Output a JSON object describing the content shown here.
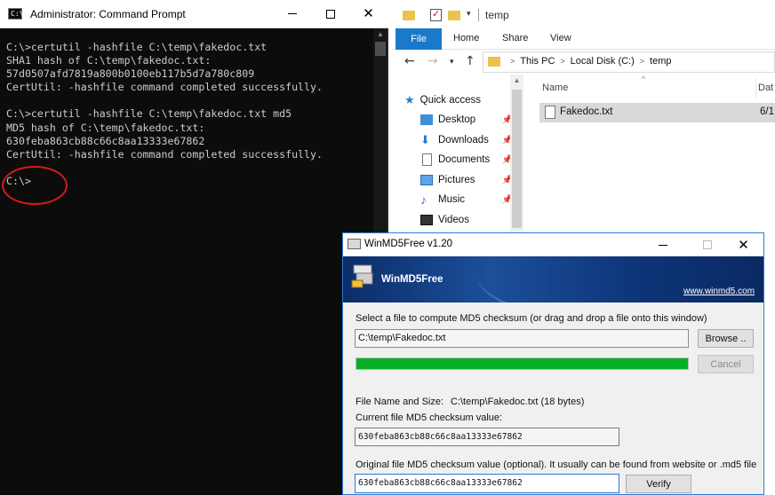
{
  "cmd": {
    "title": "Administrator: Command Prompt",
    "icon_text": "C:\\",
    "output": "C:\\>certutil -hashfile C:\\temp\\fakedoc.txt\nSHA1 hash of C:\\temp\\fakedoc.txt:\n57d0507afd7819a800b0100eb117b5d7a780c809\nCertUtil: -hashfile command completed successfully.\n\nC:\\>certutil -hashfile C:\\temp\\fakedoc.txt md5\nMD5 hash of C:\\temp\\fakedoc.txt:\n630feba863cb88c66c8aa13333e67862\nCertUtil: -hashfile command completed successfully.\n\nC:\\>",
    "annotation_color": "#d21c1c"
  },
  "explorer": {
    "title": "temp",
    "ribbon_tabs": {
      "file": "File",
      "home": "Home",
      "share": "Share",
      "view": "View"
    },
    "address": {
      "part1": "This PC",
      "part2": "Local Disk (C:)",
      "part3": "temp",
      "sep": ">"
    },
    "nav_items": [
      {
        "label": "Quick access",
        "icon": "star-icon"
      },
      {
        "label": "Desktop",
        "icon": "desktop-icon"
      },
      {
        "label": "Downloads",
        "icon": "download-icon"
      },
      {
        "label": "Documents",
        "icon": "documents-icon"
      },
      {
        "label": "Pictures",
        "icon": "pictures-icon"
      },
      {
        "label": "Music",
        "icon": "music-icon"
      },
      {
        "label": "Videos",
        "icon": "videos-icon"
      }
    ],
    "columns": {
      "name": "Name",
      "date": "Dat"
    },
    "file": {
      "name": "Fakedoc.txt",
      "date": "6/1"
    },
    "accent": "#1979ca"
  },
  "md5": {
    "title": "WinMD5Free v1.20",
    "banner_title": "WinMD5Free",
    "banner_url": "www.winmd5.com",
    "select_label": "Select a file to compute MD5 checksum (or drag and drop a file onto this window)",
    "path_value": "C:\\temp\\Fakedoc.txt",
    "browse_label": "Browse ..",
    "cancel_label": "Cancel",
    "progress": 1.0,
    "filesize_label": "File Name and Size:",
    "filesize_value": "C:\\temp\\Fakedoc.txt (18 bytes)",
    "current_label": "Current file MD5 checksum value:",
    "current_value": "630feba863cb88c66c8aa13333e67862",
    "original_label": "Original file MD5 checksum value (optional). It usually can be found from website or .md5 file",
    "original_value": "630feba863cb88c66c8aa13333e67862",
    "verify_label": "Verify",
    "progress_color": "#06b025"
  }
}
